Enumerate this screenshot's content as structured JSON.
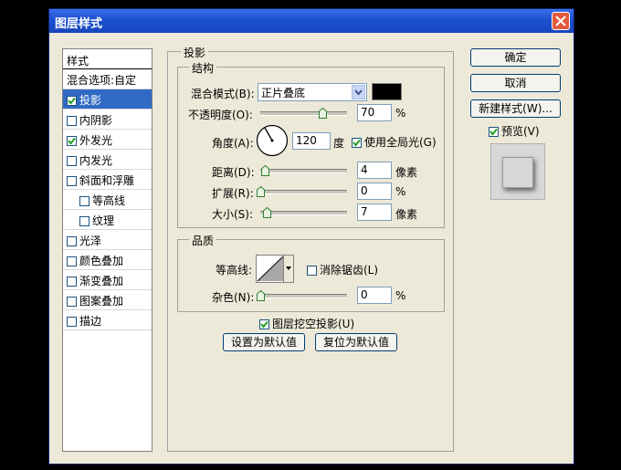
{
  "window": {
    "title": "图层样式"
  },
  "style_list": {
    "header": "样式",
    "blend_options": "混合选项:自定",
    "items": [
      {
        "label": "投影",
        "checked": true,
        "selected": true,
        "sub": false
      },
      {
        "label": "内阴影",
        "checked": false,
        "selected": false,
        "sub": false
      },
      {
        "label": "外发光",
        "checked": true,
        "selected": false,
        "sub": false
      },
      {
        "label": "内发光",
        "checked": false,
        "selected": false,
        "sub": false
      },
      {
        "label": "斜面和浮雕",
        "checked": false,
        "selected": false,
        "sub": false
      },
      {
        "label": "等高线",
        "checked": false,
        "selected": false,
        "sub": true
      },
      {
        "label": "纹理",
        "checked": false,
        "selected": false,
        "sub": true
      },
      {
        "label": "光泽",
        "checked": false,
        "selected": false,
        "sub": false
      },
      {
        "label": "颜色叠加",
        "checked": false,
        "selected": false,
        "sub": false
      },
      {
        "label": "渐变叠加",
        "checked": false,
        "selected": false,
        "sub": false
      },
      {
        "label": "图案叠加",
        "checked": false,
        "selected": false,
        "sub": false
      },
      {
        "label": "描边",
        "checked": false,
        "selected": false,
        "sub": false
      }
    ]
  },
  "buttons": {
    "ok": "确定",
    "cancel": "取消",
    "new_style": "新建样式(W)...",
    "preview": "预览(V)",
    "preview_checked": true
  },
  "drop_shadow": {
    "title": "投影",
    "structure": {
      "title": "结构",
      "blend_mode_label": "混合模式(B):",
      "blend_mode": "正片叠底",
      "blend_color": "#000000",
      "opacity_label": "不透明度(O):",
      "opacity": "70",
      "opacity_unit": "%",
      "angle_label": "角度(A):",
      "angle": "120",
      "angle_unit": "度",
      "global_light_label": "使用全局光(G)",
      "global_light": true,
      "distance_label": "距离(D):",
      "distance": "4",
      "distance_unit": "像素",
      "spread_label": "扩展(R):",
      "spread": "0",
      "spread_unit": "%",
      "size_label": "大小(S):",
      "size": "7",
      "size_unit": "像素"
    },
    "quality": {
      "title": "品质",
      "contour_label": "等高线:",
      "anti_alias_label": "消除锯齿(L)",
      "anti_alias": false,
      "noise_label": "杂色(N):",
      "noise": "0",
      "noise_unit": "%"
    },
    "knockout_label": "图层挖空投影(U)",
    "knockout": true,
    "make_default": "设置为默认值",
    "reset_default": "复位为默认值"
  }
}
